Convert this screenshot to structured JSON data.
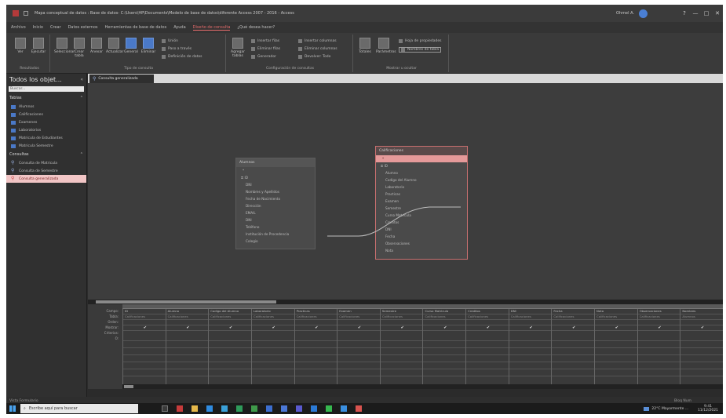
{
  "window": {
    "title": "Mapa conceptual de datos : Base de datos- C:\\Users\\HP\\Documents\\Modelo de base de datos\\diferente Access 2007 - 2016 - Access",
    "user": "Ohmel A.",
    "controls": [
      "?",
      "—",
      "□",
      "✕"
    ]
  },
  "ribbon": {
    "tabs": [
      "Archivo",
      "Inicio",
      "Crear",
      "Datos externos",
      "Herramientas de base de datos",
      "Ayuda",
      "Diseño de consulta",
      "¿Qué desea hacer?"
    ],
    "active_tab": "Diseño de consulta",
    "groups": [
      {
        "label": "Resultados",
        "buttons": [
          "Ver",
          "Ejecutar"
        ]
      },
      {
        "label": "Tipo de consulta",
        "buttons": [
          "Seleccionar",
          "Crear tabla",
          "Anexar",
          "Actualizar",
          "General",
          "Eliminar"
        ],
        "small": [
          "Unión",
          "Paso a través",
          "Definición de datos"
        ]
      },
      {
        "label": "Configuración de consultas",
        "buttons": [
          "Agregar tablas"
        ],
        "small": [
          "Insertar filas",
          "Eliminar filas",
          "Generador",
          "Insertar columnas",
          "Eliminar columnas",
          "Devolver: Todo"
        ]
      },
      {
        "label": "Mostrar u ocultar",
        "buttons": [
          "Totales",
          "Parámetros"
        ],
        "small": [
          "Hoja de propiedades",
          "Nombres de tabla"
        ]
      }
    ]
  },
  "nav": {
    "title": "Todos los objet...",
    "search_placeholder": "Buscar...",
    "section_tables": "Tablas",
    "tables": [
      "Alumnos",
      "Calificaciones",
      "Examenes",
      "Laboratorios",
      "Matricula de Estudiantes",
      "Matricula Semestre"
    ],
    "section_queries": "Consultas",
    "queries": [
      "Consulta de Matricula",
      "Consulta de Semestre",
      "Consulta generalizada"
    ],
    "selected_query": "Consulta generalizada"
  },
  "document": {
    "tab_label": "Consulta generalizada"
  },
  "tables": {
    "left": {
      "name": "Alumnos",
      "fields": [
        "*",
        "ID",
        "DNI",
        "Nombres y Apellidos",
        "Fecha de Nacimiento",
        "Dirección",
        "EMAIL",
        "DNI",
        "Teléfono",
        "Institución de Procedencia",
        "Colegio"
      ]
    },
    "right": {
      "name": "Calificaciones",
      "fields": [
        "*",
        "ID",
        "Alumno",
        "Codigo del Alumno",
        "Laboratorio",
        "Practicas",
        "Examen",
        "Semestre",
        "Curso Matricula",
        "Creditos",
        "DNI",
        "Fecha",
        "Observaciones",
        "Nota"
      ],
      "selected_field": "*"
    }
  },
  "grid": {
    "row_labels": [
      "Campo:",
      "Tabla:",
      "Orden:",
      "Mostrar:",
      "Criterios:",
      "O:"
    ],
    "columns": [
      {
        "field": "ID",
        "table": "Calificaciones"
      },
      {
        "field": "Alumno",
        "table": "Calificaciones"
      },
      {
        "field": "Codigo del Alumno",
        "table": "Calificaciones"
      },
      {
        "field": "Laboratorio",
        "table": "Calificaciones"
      },
      {
        "field": "Practicas",
        "table": "Calificaciones"
      },
      {
        "field": "Examen",
        "table": "Calificaciones"
      },
      {
        "field": "Semestre",
        "table": "Calificaciones"
      },
      {
        "field": "Curso Matricula",
        "table": "Calificaciones"
      },
      {
        "field": "Creditos",
        "table": "Calificaciones"
      },
      {
        "field": "DNI",
        "table": "Calificaciones"
      },
      {
        "field": "Fecha",
        "table": "Calificaciones"
      },
      {
        "field": "Nota",
        "table": "Calificaciones"
      },
      {
        "field": "Observaciones",
        "table": "Calificaciones"
      },
      {
        "field": "Nombres",
        "table": "Alumnos"
      }
    ]
  },
  "status": {
    "left": "Vista Formulario",
    "right": "Bloq Num"
  },
  "taskbar": {
    "search_placeholder": "Escribe aquí para buscar",
    "weather": "22°C Mayormente ...",
    "time": "9:41",
    "date": "11/12/2021"
  },
  "colors": {
    "accent": "#e86c6c",
    "selected_nav_bg": "#f1c5c5",
    "taskbar_bg": "#1b1b1b"
  }
}
